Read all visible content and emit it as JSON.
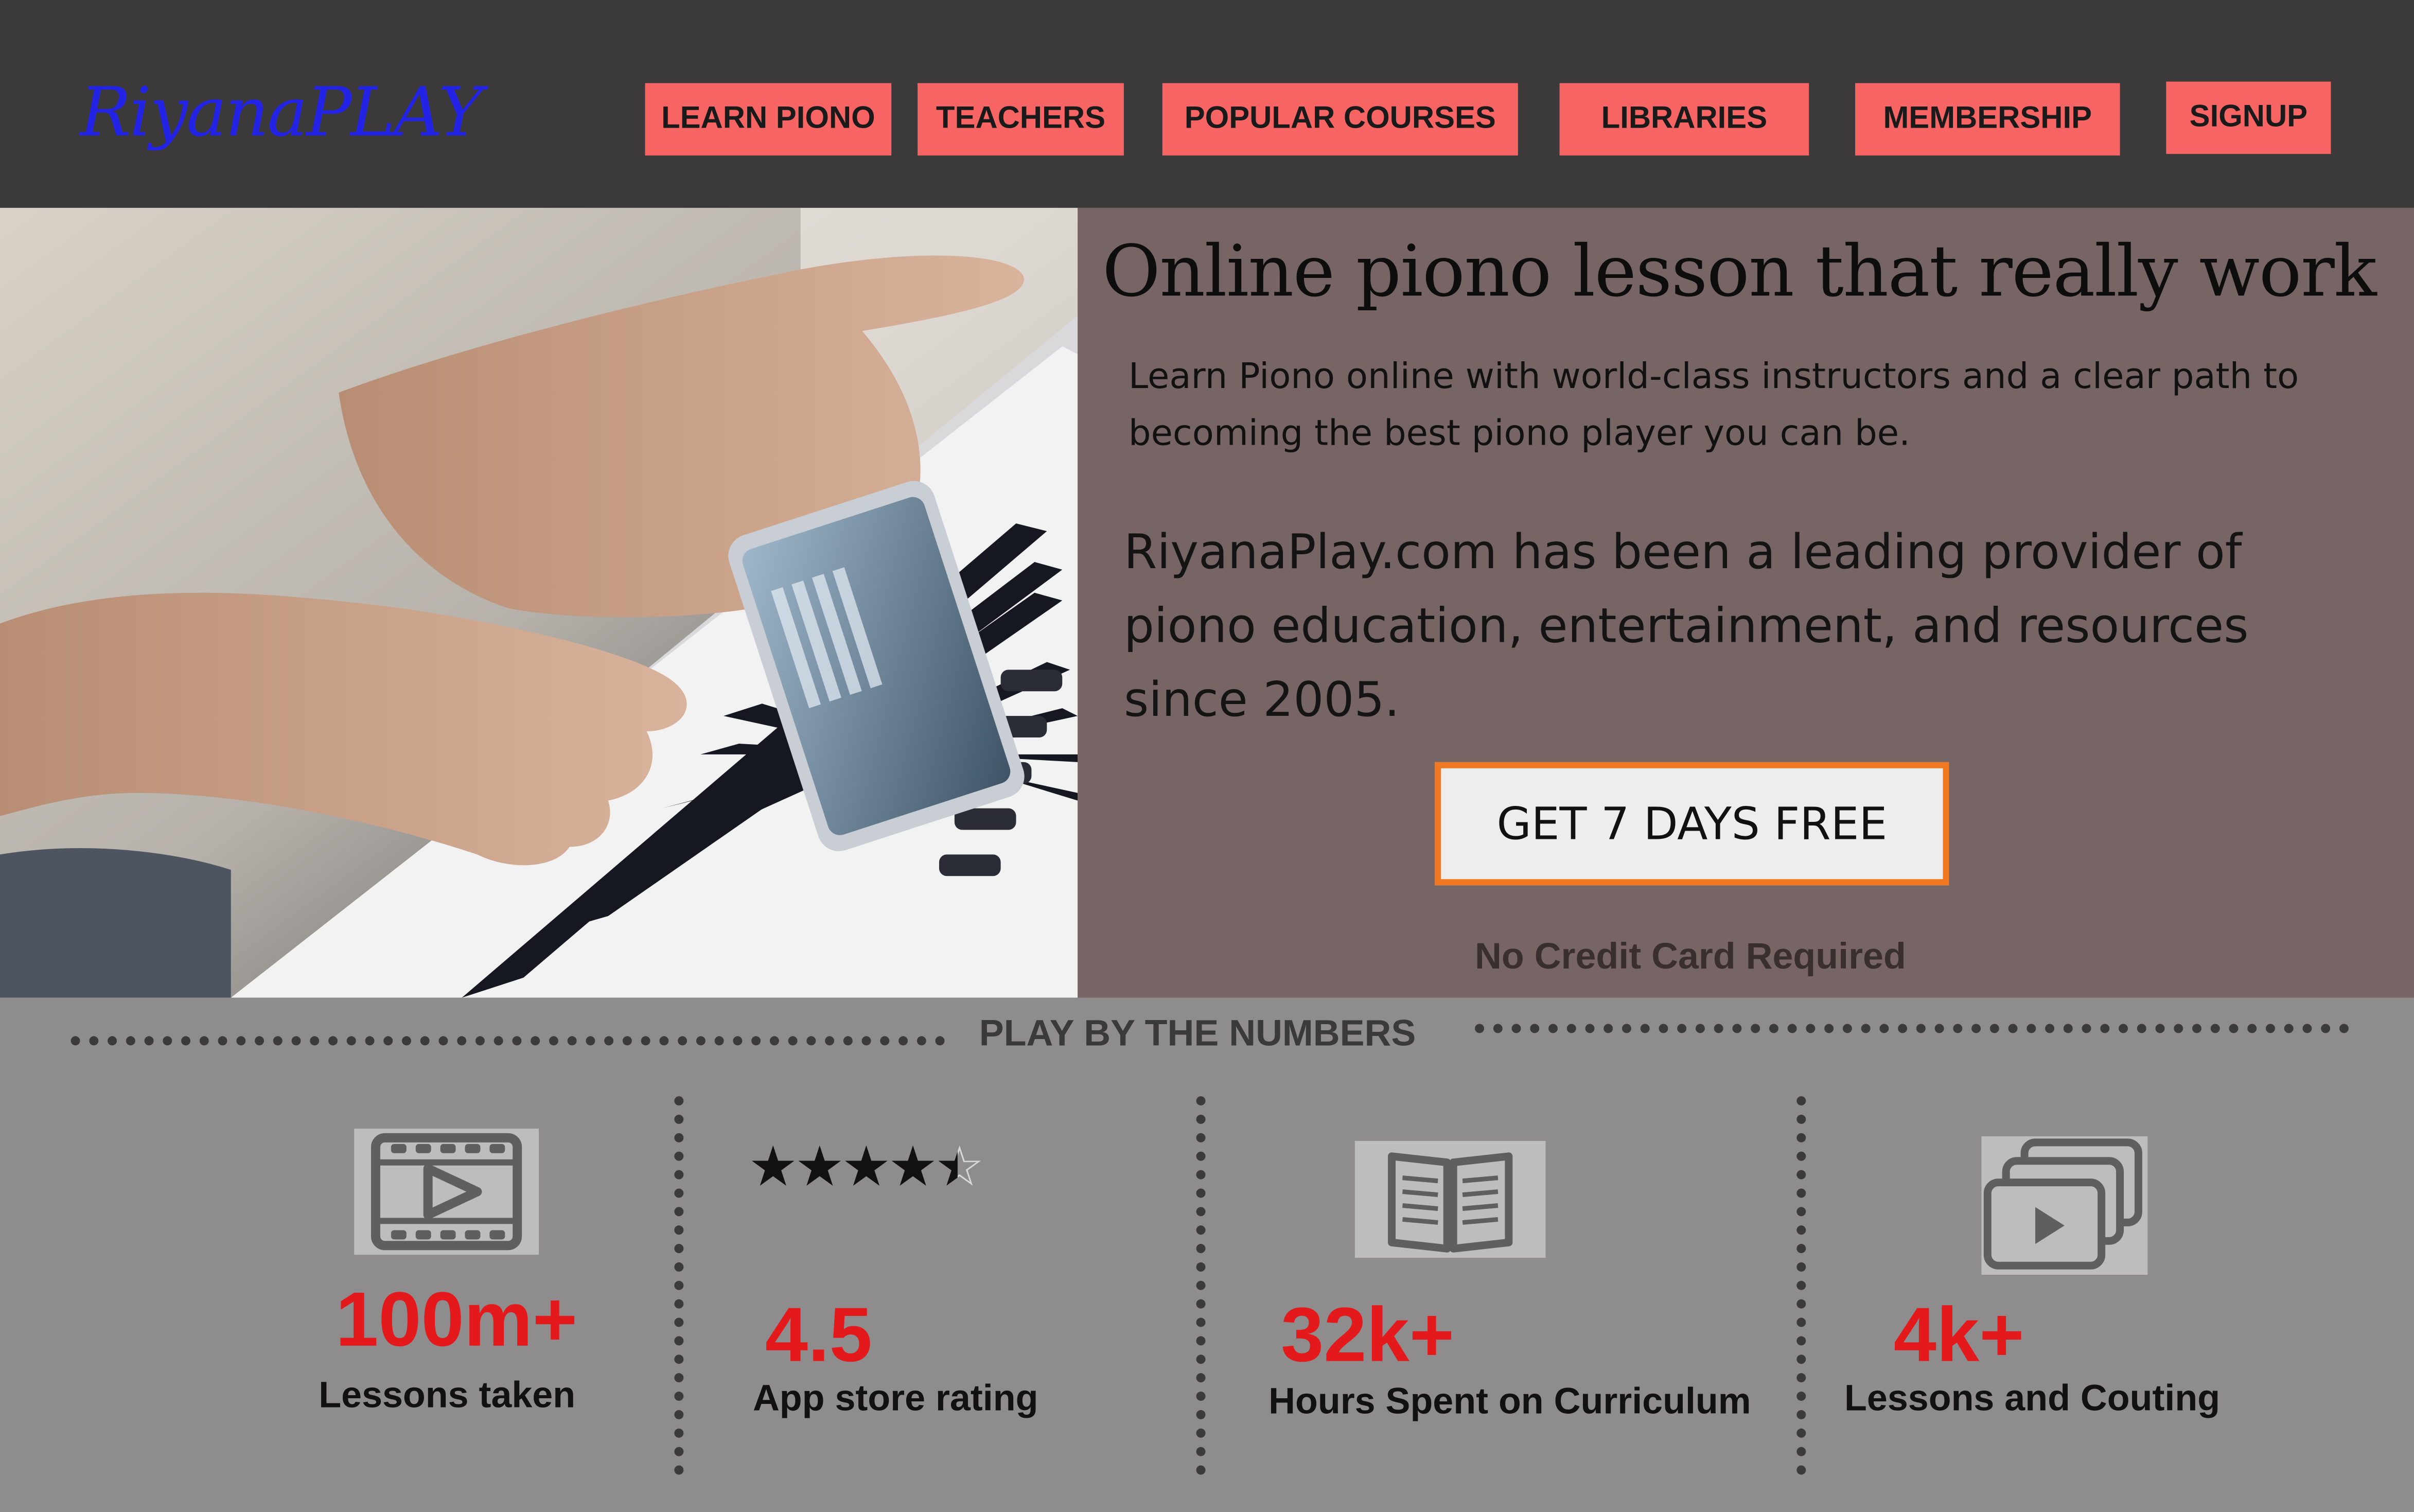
{
  "brand": {
    "logo": "RiyanaPLAY"
  },
  "nav": {
    "items": [
      "LEARN PIONO",
      "TEACHERS",
      "POPULAR COURSES",
      "LIBRARIES",
      "MEMBERSHIP",
      "SIGNUP"
    ]
  },
  "hero": {
    "headline": "Online piono lesson that really work",
    "subline": "Learn Piono online with world-class instructors and a clear path to becoming the best piono player you can be.",
    "about": "RiyanaPlay.com has been a leading provider of piono education, entertainment, and resources since 2005.",
    "cta": "GET 7 DAYS FREE",
    "cta_note": "No Credit Card Required"
  },
  "numbers": {
    "title": "PLAY BY THE NUMBERS",
    "rating_stars": 4.5,
    "stats": [
      {
        "icon": "video-film-icon",
        "value": "100m+",
        "label": "Lessons taken"
      },
      {
        "icon": "star-rating-icon",
        "value": "4.5",
        "label": "App store rating"
      },
      {
        "icon": "open-book-icon",
        "value": "32k+",
        "label": "Hours Spent on Curriculum"
      },
      {
        "icon": "video-library-icon",
        "value": "4k+",
        "label": "Lessons and Couting"
      }
    ]
  },
  "colors": {
    "header_bg": "#3b393a",
    "nav_button": "#f66464",
    "logo": "#2323e6",
    "hero_panel": "#766564",
    "cta_border": "#f07820",
    "stat_value": "#e3191b",
    "stats_bg": "#8e8c8c"
  }
}
